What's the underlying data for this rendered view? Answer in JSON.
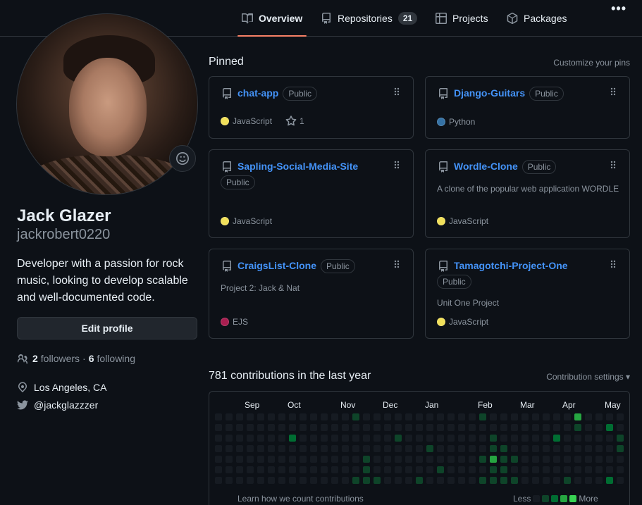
{
  "nav": {
    "tabs": [
      {
        "label": "Overview",
        "icon": "book-icon"
      },
      {
        "label": "Repositories",
        "icon": "repo-icon",
        "count": "21"
      },
      {
        "label": "Projects",
        "icon": "table-icon"
      },
      {
        "label": "Packages",
        "icon": "package-icon"
      }
    ],
    "more": "•••"
  },
  "profile": {
    "name": "Jack Glazer",
    "login": "jackrobert0220",
    "bio": "Developer with a passion for rock music, looking to develop scalable and well-documented code.",
    "edit_label": "Edit profile",
    "followers_count": "2",
    "followers_label": "followers",
    "separator": "·",
    "following_count": "6",
    "following_label": "following",
    "location": "Los Angeles, CA",
    "twitter": "@jackglazzzer"
  },
  "pinned": {
    "title": "Pinned",
    "customize_label": "Customize your pins",
    "cards": [
      {
        "name": "chat-app",
        "visibility": "Public",
        "description": "",
        "language": "JavaScript",
        "lang_color": "#f1e05a",
        "stars": "1"
      },
      {
        "name": "Django-Guitars",
        "visibility": "Public",
        "description": "",
        "language": "Python",
        "lang_color": "#3572A5"
      },
      {
        "name": "Sapling-Social-Media-Site",
        "visibility": "Public",
        "description": "",
        "language": "JavaScript",
        "lang_color": "#f1e05a"
      },
      {
        "name": "Wordle-Clone",
        "visibility": "Public",
        "description": "A clone of the popular web application WORDLE",
        "language": "JavaScript",
        "lang_color": "#f1e05a"
      },
      {
        "name": "CraigsList-Clone",
        "visibility": "Public",
        "description": "Project 2: Jack & Nat",
        "language": "EJS",
        "lang_color": "#a91e50"
      },
      {
        "name": "Tamagotchi-Project-One",
        "visibility": "Public",
        "description": "Unit One Project",
        "language": "JavaScript",
        "lang_color": "#f1e05a"
      }
    ]
  },
  "contributions": {
    "title": "781 contributions in the last year",
    "settings_label": "Contribution settings",
    "months": [
      "Sep",
      "Oct",
      "Nov",
      "Dec",
      "Jan",
      "Feb",
      "Mar",
      "Apr",
      "May"
    ],
    "learn_label": "Learn how we count contributions",
    "less_label": "Less",
    "more_label": "More",
    "colors": [
      "#161b22",
      "#0e4429",
      "#006d32",
      "#26a641",
      "#39d353"
    ],
    "grid": [
      "0000000000000000000000000000000000000000000000000000",
      "0000000000000000000000000000000000000000000000000000",
      "0000000000000000000000000000000000000000000000000000",
      "0000000000000000000000000000000000000000000000000000",
      "0000000000000000000000000000000000000000000000000000",
      "0000000000000000000000000000000000000000000000000000",
      "0000000000000000000000000000000000000000000000000000"
    ]
  }
}
